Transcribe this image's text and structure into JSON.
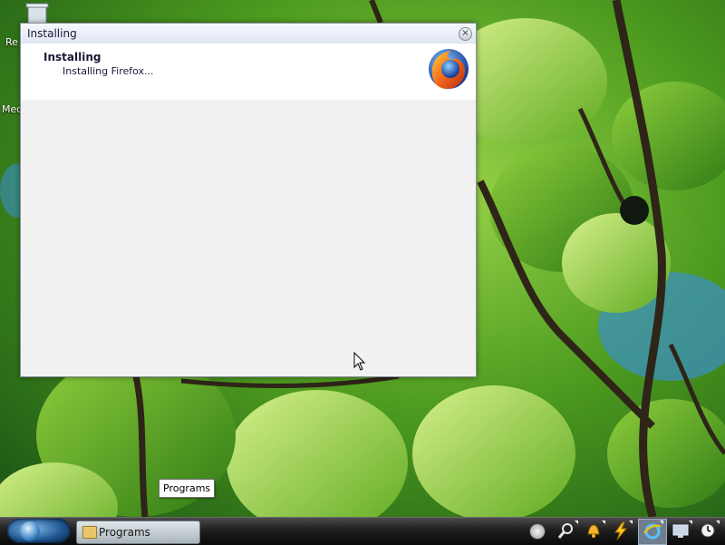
{
  "desktop": {
    "icons": [
      {
        "label": "Re",
        "name": "recycle-bin-icon"
      },
      {
        "label": "Med",
        "name": "media-icon"
      }
    ]
  },
  "dialog": {
    "title": "Installing",
    "close_symbol": "×",
    "header_title": "Installing",
    "header_subtitle": "Installing Firefox...",
    "logo_icon": "firefox-logo-icon"
  },
  "tooltip": {
    "text": "Programs"
  },
  "taskbar": {
    "start_icon": "windows-start-orb-icon",
    "task_button_label": "Programs",
    "tray_icons": [
      "magnifier-icon",
      "bell-icon",
      "lightning-icon",
      "ie-icon",
      "monitor-icon",
      "clock-icon"
    ]
  },
  "colors": {
    "taskbar_bg": "#1e1e1e",
    "dialog_bg": "#f1f1f1",
    "header_bg": "#ffffff",
    "title_text": "#1a1a3a"
  }
}
